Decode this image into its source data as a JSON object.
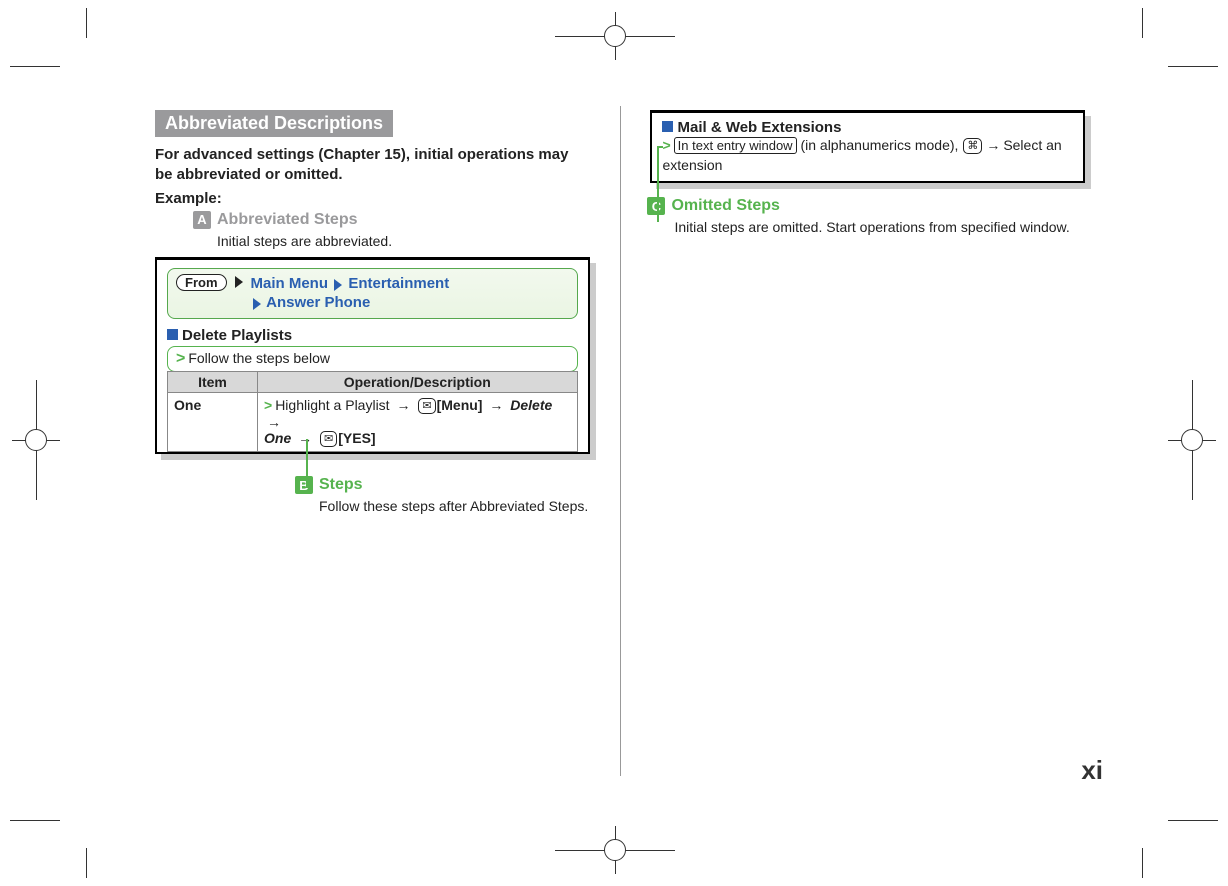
{
  "heading": "Abbreviated Descriptions",
  "intro": "For advanced settings (Chapter 15), initial operations may be abbreviated or omitted.",
  "example_label": "Example:",
  "callout_a": {
    "letter": "A",
    "title": "Abbreviated Steps",
    "sub": "Initial steps are abbreviated."
  },
  "from_chip": "From",
  "crumb": {
    "a": "Main Menu",
    "b": "Entertainment",
    "c": "Answer Phone"
  },
  "panel1_heading": "Delete Playlists",
  "follow_steps": "Follow the steps below",
  "table": {
    "h1": "Item",
    "h2": "Operation/Description",
    "row1_item": "One",
    "row1_ops": {
      "p1": "Highlight a Playlist",
      "menu_key": "✉",
      "menu_label": "[Menu]",
      "delete": "Delete",
      "one": "One",
      "yes_key": "✉",
      "yes_label": "[YES]"
    }
  },
  "callout_b": {
    "letter": "B",
    "title": "Steps",
    "sub": "Follow these steps after Abbreviated Steps."
  },
  "panel2_heading": "Mail & Web Extensions",
  "panel2_body": {
    "boxed": "In text entry window",
    "after_box": "(in alphanumerics mode),",
    "key": "⌘",
    "tail": "Select an extension"
  },
  "callout_c": {
    "letter": "C",
    "title": "Omitted Steps",
    "sub": "Initial steps are omitted. Start operations from specified window."
  },
  "page_number": "xi"
}
